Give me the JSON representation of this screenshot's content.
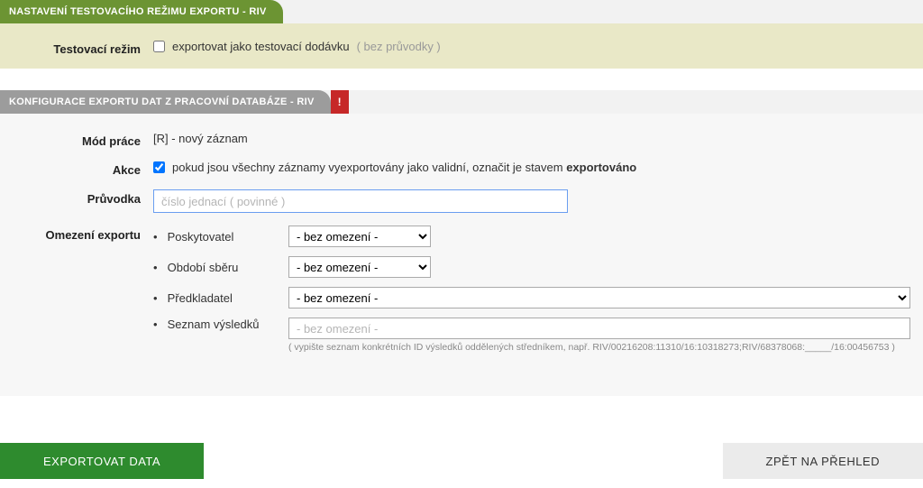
{
  "test_panel": {
    "header": "NASTAVENÍ TESTOVACÍHO REŽIMU EXPORTU - RIV",
    "label": "Testovací režim",
    "checkbox_text": "exportovat jako testovací dodávku",
    "hint": "( bez průvodky )"
  },
  "config_panel": {
    "header": "KONFIGURACE EXPORTU DAT Z PRACOVNÍ DATABÁZE - RIV",
    "badge": "!",
    "mode": {
      "label": "Mód práce",
      "value": "[R] - nový záznam"
    },
    "akce": {
      "label": "Akce",
      "text_before": "pokud jsou všechny záznamy vyexportovány jako validní, označit je stavem",
      "text_bold": "exportováno"
    },
    "pruvodka": {
      "label": "Průvodka",
      "placeholder": "číslo jednací ( povinné )"
    },
    "omezeni": {
      "label": "Omezení exportu",
      "poskytovatel": {
        "label": "Poskytovatel",
        "option": "- bez omezení -"
      },
      "obdobi": {
        "label": "Období sběru",
        "option": "- bez omezení -"
      },
      "predkladatel": {
        "label": "Předkladatel",
        "option": "- bez omezení -"
      },
      "seznam": {
        "label": "Seznam výsledků",
        "placeholder": "- bez omezení -",
        "hint": "( vypište seznam konkrétních ID výsledků oddělených středníkem, např. RIV/00216208:11310/16:10318273;RIV/68378068:_____/16:00456753 )"
      }
    }
  },
  "buttons": {
    "export": "EXPORTOVAT DATA",
    "back": "ZPĚT NA PŘEHLED"
  },
  "colors": {
    "olive_tab": "#6c9433",
    "olive_bg": "#e9e8c7",
    "grey_tab": "#9c9c9c",
    "grey_bg": "#f7f7f7",
    "alert": "#c62828",
    "primary_btn": "#2e8b2e",
    "secondary_btn": "#ebebeb"
  }
}
